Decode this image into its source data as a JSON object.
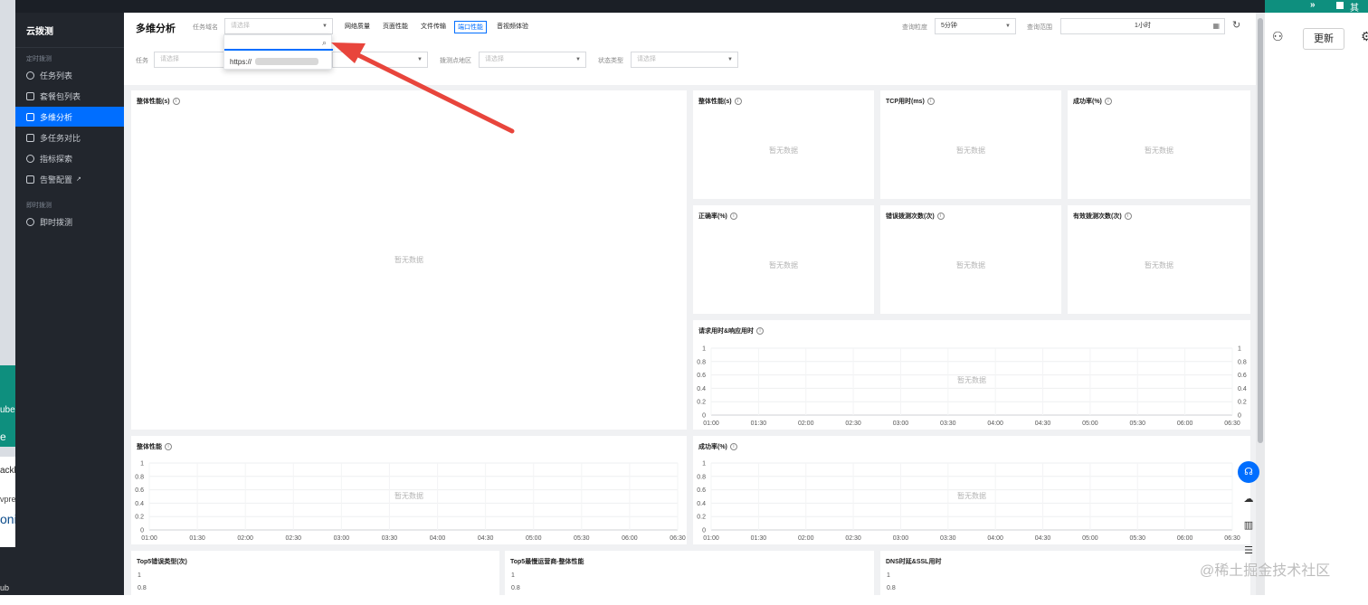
{
  "colors": {
    "accent": "#006eff",
    "arrow": "#e8453c",
    "sidebar_bg": "#22262d",
    "teal": "#0e8f7e"
  },
  "sidebar": {
    "brand": "云拨测",
    "group1": "定时拨测",
    "group2": "即时拨测",
    "items": [
      {
        "label": "任务列表",
        "icon": "clock-icon"
      },
      {
        "label": "套餐包列表",
        "icon": "package-icon"
      },
      {
        "label": "多维分析",
        "icon": "analysis-icon",
        "active": true
      },
      {
        "label": "多任务对比",
        "icon": "compare-icon"
      },
      {
        "label": "指标探索",
        "icon": "explore-icon"
      },
      {
        "label": "告警配置",
        "icon": "alarm-icon",
        "external": "↗"
      },
      {
        "label": "即时拨测",
        "icon": "lightning-icon"
      }
    ]
  },
  "header": {
    "title": "多维分析",
    "domain_label": "任务域名",
    "domain_placeholder": "请选择",
    "tabs": [
      "网络质量",
      "页面性能",
      "文件传输",
      "端口性能",
      "音视频体验"
    ],
    "active_tab": 3,
    "granularity_label": "查询粒度",
    "granularity_value": "5分钟",
    "range_label": "查询范围",
    "range_value": "1小时",
    "task_label": "任务",
    "task_placeholder": "请选择",
    "region_label": "拨测点地区",
    "region_placeholder": "请选择",
    "status_label": "状态类型",
    "status_placeholder": "请选择",
    "dropdown_option": "https://"
  },
  "empty_text": "暂无数据",
  "cards": {
    "big_perf": "整体性能(s)",
    "perf_small": "整体性能(s)",
    "tcp": "TCP用时(ms)",
    "success": "成功率(%)",
    "correct": "正确率(%)",
    "err_count": "错误拨测次数(次)",
    "valid_count": "有效拨测次数(次)",
    "req_resp": "请求用时&响应用时",
    "perf_line": "整体性能",
    "success_line": "成功率(%)",
    "top5_err": "Top5错误类型(次)",
    "top5_slow": "Top5最慢运营商-整体性能",
    "dns_ssl": "DNS时延&SSL用时"
  },
  "chart_data": [
    {
      "type": "line",
      "title": "请求用时&响应用时",
      "x": [
        "01:00",
        "01:30",
        "02:00",
        "02:30",
        "03:00",
        "03:30",
        "04:00",
        "04:30",
        "05:00",
        "05:30",
        "06:00",
        "06:30"
      ],
      "yticks_left": [
        "1",
        "0.8",
        "0.6",
        "0.4",
        "0.2",
        "0"
      ],
      "yticks_right": [
        "1",
        "0.8",
        "0.6",
        "0.4",
        "0.2",
        "0"
      ],
      "ylim": [
        0,
        1
      ],
      "series": []
    },
    {
      "type": "line",
      "title": "整体性能",
      "x": [
        "01:00",
        "01:30",
        "02:00",
        "02:30",
        "03:00",
        "03:30",
        "04:00",
        "04:30",
        "05:00",
        "05:30",
        "06:00",
        "06:30"
      ],
      "yticks_left": [
        "1",
        "0.8",
        "0.6",
        "0.4",
        "0.2",
        "0"
      ],
      "ylim": [
        0,
        1
      ],
      "series": []
    },
    {
      "type": "line",
      "title": "成功率(%)",
      "x": [
        "01:00",
        "01:30",
        "02:00",
        "02:30",
        "03:00",
        "03:30",
        "04:00",
        "04:30",
        "05:00",
        "05:30",
        "06:00",
        "06:30"
      ],
      "yticks_left": [
        "1",
        "0.8",
        "0.6",
        "0.4",
        "0.2",
        "0"
      ],
      "ylim": [
        0,
        1
      ],
      "series": []
    },
    {
      "type": "line",
      "title": "Top5错误类型(次)",
      "yticks_left": [
        "1",
        "0.8"
      ]
    },
    {
      "type": "line",
      "title": "Top5最慢运营商-整体性能",
      "yticks_left": [
        "1",
        "0.8"
      ]
    },
    {
      "type": "line",
      "title": "DNS时延&SSL用时",
      "yticks_left": [
        "1",
        "0.8"
      ]
    }
  ],
  "right_panel": {
    "chevron": "»",
    "top_text": "其",
    "update_label": "更新",
    "watermark": "@稀土掘金技术社区"
  },
  "left_strip": [
    "ube",
    "e",
    "ackb",
    "vpre",
    "oni",
    "ub"
  ],
  "float_tools": [
    "headset-icon",
    "cloud-icon",
    "book-icon",
    "list-icon"
  ]
}
